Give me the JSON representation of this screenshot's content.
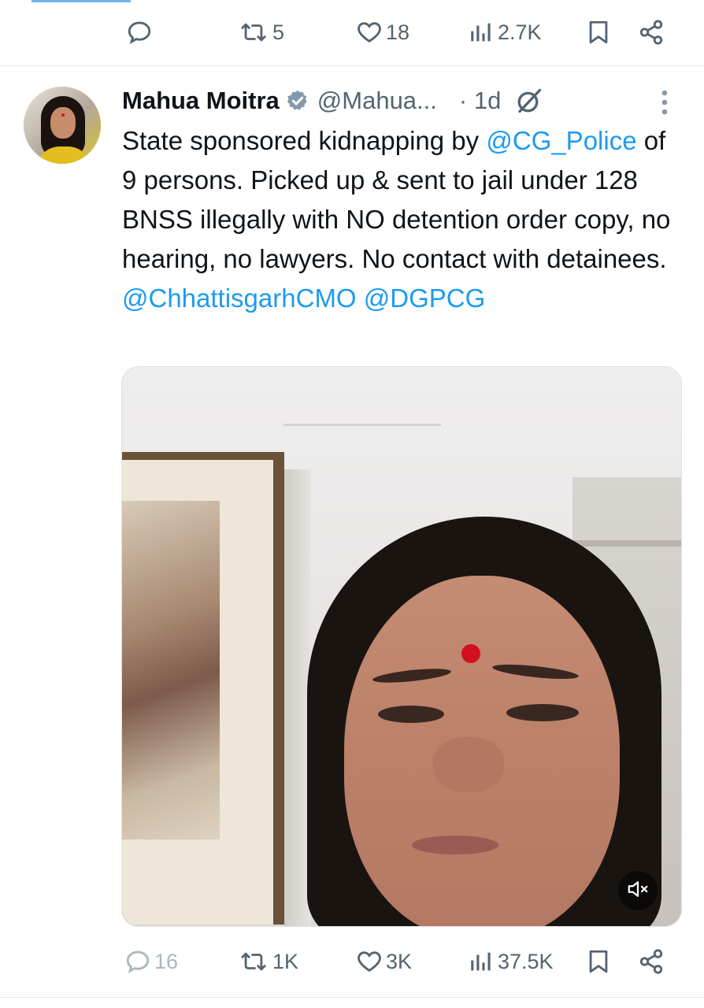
{
  "previous_tweet": {
    "actions": {
      "replies": "",
      "retweets": "5",
      "likes": "18",
      "views": "2.7K"
    }
  },
  "tweet": {
    "author_name": "Mahua Moitra",
    "verified": true,
    "handle": "@Mahua...",
    "time": "· 1d",
    "text_segments": [
      "State sponsored kidnapping by ",
      "@CG_Police",
      " of 9 persons. Picked up & sent to jail under 128 BNSS illegally with NO detention order copy, no hearing, no lawyers. No contact with detainees. ",
      "@ChhattisgarhCMO",
      " ",
      "@DGPCG"
    ],
    "media": {
      "muted": true,
      "icon": "volume-muted-icon"
    },
    "actions": {
      "replies": "16",
      "retweets": "1K",
      "likes": "3K",
      "views": "37.5K"
    }
  },
  "colors": {
    "accent": "#1d9bf0",
    "muted_text": "#536471",
    "verified_badge": "#829aab",
    "dim_reply": "#a9b7c2"
  }
}
